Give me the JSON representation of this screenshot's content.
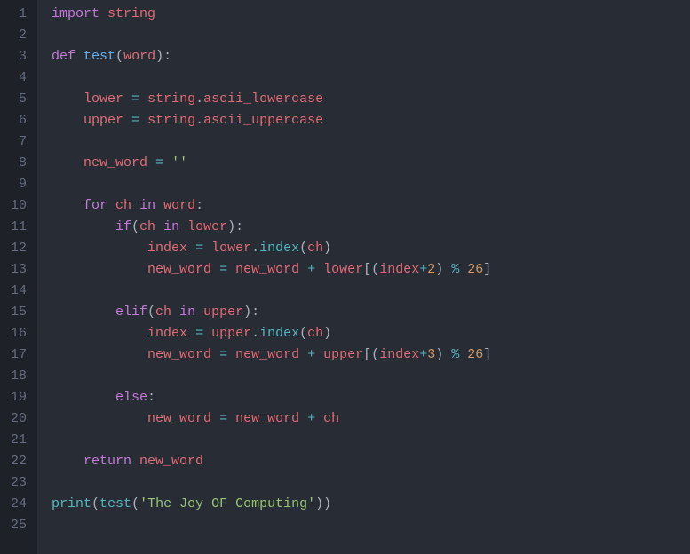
{
  "editor": {
    "lines": [
      {
        "num": "1",
        "tokens": [
          {
            "cls": "tok-import",
            "text": "import"
          },
          {
            "cls": "tok-default",
            "text": " "
          },
          {
            "cls": "tok-ident",
            "text": "string"
          }
        ]
      },
      {
        "num": "2",
        "tokens": []
      },
      {
        "num": "3",
        "tokens": [
          {
            "cls": "tok-keyword",
            "text": "def"
          },
          {
            "cls": "tok-default",
            "text": " "
          },
          {
            "cls": "tok-funcname",
            "text": "test"
          },
          {
            "cls": "tok-punct",
            "text": "("
          },
          {
            "cls": "tok-param",
            "text": "word"
          },
          {
            "cls": "tok-punct",
            "text": "):"
          }
        ]
      },
      {
        "num": "4",
        "tokens": []
      },
      {
        "num": "5",
        "tokens": [
          {
            "cls": "tok-default",
            "text": "    "
          },
          {
            "cls": "tok-ident",
            "text": "lower"
          },
          {
            "cls": "tok-default",
            "text": " "
          },
          {
            "cls": "tok-operator",
            "text": "="
          },
          {
            "cls": "tok-default",
            "text": " "
          },
          {
            "cls": "tok-ident",
            "text": "string"
          },
          {
            "cls": "tok-punct",
            "text": "."
          },
          {
            "cls": "tok-attr",
            "text": "ascii_lowercase"
          }
        ]
      },
      {
        "num": "6",
        "tokens": [
          {
            "cls": "tok-default",
            "text": "    "
          },
          {
            "cls": "tok-ident",
            "text": "upper"
          },
          {
            "cls": "tok-default",
            "text": " "
          },
          {
            "cls": "tok-operator",
            "text": "="
          },
          {
            "cls": "tok-default",
            "text": " "
          },
          {
            "cls": "tok-ident",
            "text": "string"
          },
          {
            "cls": "tok-punct",
            "text": "."
          },
          {
            "cls": "tok-attr",
            "text": "ascii_uppercase"
          }
        ]
      },
      {
        "num": "7",
        "tokens": []
      },
      {
        "num": "8",
        "tokens": [
          {
            "cls": "tok-default",
            "text": "    "
          },
          {
            "cls": "tok-ident",
            "text": "new_word"
          },
          {
            "cls": "tok-default",
            "text": " "
          },
          {
            "cls": "tok-operator",
            "text": "="
          },
          {
            "cls": "tok-default",
            "text": " "
          },
          {
            "cls": "tok-string",
            "text": "''"
          }
        ]
      },
      {
        "num": "9",
        "tokens": []
      },
      {
        "num": "10",
        "tokens": [
          {
            "cls": "tok-default",
            "text": "    "
          },
          {
            "cls": "tok-keyword",
            "text": "for"
          },
          {
            "cls": "tok-default",
            "text": " "
          },
          {
            "cls": "tok-ident",
            "text": "ch"
          },
          {
            "cls": "tok-default",
            "text": " "
          },
          {
            "cls": "tok-keyword",
            "text": "in"
          },
          {
            "cls": "tok-default",
            "text": " "
          },
          {
            "cls": "tok-ident",
            "text": "word"
          },
          {
            "cls": "tok-punct",
            "text": ":"
          }
        ]
      },
      {
        "num": "11",
        "tokens": [
          {
            "cls": "tok-default",
            "text": "        "
          },
          {
            "cls": "tok-keyword",
            "text": "if"
          },
          {
            "cls": "tok-punct",
            "text": "("
          },
          {
            "cls": "tok-ident",
            "text": "ch"
          },
          {
            "cls": "tok-default",
            "text": " "
          },
          {
            "cls": "tok-keyword",
            "text": "in"
          },
          {
            "cls": "tok-default",
            "text": " "
          },
          {
            "cls": "tok-ident",
            "text": "lower"
          },
          {
            "cls": "tok-punct",
            "text": "):"
          }
        ]
      },
      {
        "num": "12",
        "tokens": [
          {
            "cls": "tok-default",
            "text": "            "
          },
          {
            "cls": "tok-ident",
            "text": "index"
          },
          {
            "cls": "tok-default",
            "text": " "
          },
          {
            "cls": "tok-operator",
            "text": "="
          },
          {
            "cls": "tok-default",
            "text": " "
          },
          {
            "cls": "tok-ident",
            "text": "lower"
          },
          {
            "cls": "tok-punct",
            "text": "."
          },
          {
            "cls": "tok-call",
            "text": "index"
          },
          {
            "cls": "tok-punct",
            "text": "("
          },
          {
            "cls": "tok-ident",
            "text": "ch"
          },
          {
            "cls": "tok-punct",
            "text": ")"
          }
        ]
      },
      {
        "num": "13",
        "tokens": [
          {
            "cls": "tok-default",
            "text": "            "
          },
          {
            "cls": "tok-ident",
            "text": "new_word"
          },
          {
            "cls": "tok-default",
            "text": " "
          },
          {
            "cls": "tok-operator",
            "text": "="
          },
          {
            "cls": "tok-default",
            "text": " "
          },
          {
            "cls": "tok-ident",
            "text": "new_word"
          },
          {
            "cls": "tok-default",
            "text": " "
          },
          {
            "cls": "tok-operator",
            "text": "+"
          },
          {
            "cls": "tok-default",
            "text": " "
          },
          {
            "cls": "tok-ident",
            "text": "lower"
          },
          {
            "cls": "tok-punct",
            "text": "[("
          },
          {
            "cls": "tok-ident",
            "text": "index"
          },
          {
            "cls": "tok-operator",
            "text": "+"
          },
          {
            "cls": "tok-number",
            "text": "2"
          },
          {
            "cls": "tok-punct",
            "text": ") "
          },
          {
            "cls": "tok-operator",
            "text": "%"
          },
          {
            "cls": "tok-default",
            "text": " "
          },
          {
            "cls": "tok-number",
            "text": "26"
          },
          {
            "cls": "tok-punct",
            "text": "]"
          }
        ]
      },
      {
        "num": "14",
        "tokens": []
      },
      {
        "num": "15",
        "tokens": [
          {
            "cls": "tok-default",
            "text": "        "
          },
          {
            "cls": "tok-keyword",
            "text": "elif"
          },
          {
            "cls": "tok-punct",
            "text": "("
          },
          {
            "cls": "tok-ident",
            "text": "ch"
          },
          {
            "cls": "tok-default",
            "text": " "
          },
          {
            "cls": "tok-keyword",
            "text": "in"
          },
          {
            "cls": "tok-default",
            "text": " "
          },
          {
            "cls": "tok-ident",
            "text": "upper"
          },
          {
            "cls": "tok-punct",
            "text": "):"
          }
        ]
      },
      {
        "num": "16",
        "tokens": [
          {
            "cls": "tok-default",
            "text": "            "
          },
          {
            "cls": "tok-ident",
            "text": "index"
          },
          {
            "cls": "tok-default",
            "text": " "
          },
          {
            "cls": "tok-operator",
            "text": "="
          },
          {
            "cls": "tok-default",
            "text": " "
          },
          {
            "cls": "tok-ident",
            "text": "upper"
          },
          {
            "cls": "tok-punct",
            "text": "."
          },
          {
            "cls": "tok-call",
            "text": "index"
          },
          {
            "cls": "tok-punct",
            "text": "("
          },
          {
            "cls": "tok-ident",
            "text": "ch"
          },
          {
            "cls": "tok-punct",
            "text": ")"
          }
        ]
      },
      {
        "num": "17",
        "tokens": [
          {
            "cls": "tok-default",
            "text": "            "
          },
          {
            "cls": "tok-ident",
            "text": "new_word"
          },
          {
            "cls": "tok-default",
            "text": " "
          },
          {
            "cls": "tok-operator",
            "text": "="
          },
          {
            "cls": "tok-default",
            "text": " "
          },
          {
            "cls": "tok-ident",
            "text": "new_word"
          },
          {
            "cls": "tok-default",
            "text": " "
          },
          {
            "cls": "tok-operator",
            "text": "+"
          },
          {
            "cls": "tok-default",
            "text": " "
          },
          {
            "cls": "tok-ident",
            "text": "upper"
          },
          {
            "cls": "tok-punct",
            "text": "[("
          },
          {
            "cls": "tok-ident",
            "text": "index"
          },
          {
            "cls": "tok-operator",
            "text": "+"
          },
          {
            "cls": "tok-number",
            "text": "3"
          },
          {
            "cls": "tok-punct",
            "text": ") "
          },
          {
            "cls": "tok-operator",
            "text": "%"
          },
          {
            "cls": "tok-default",
            "text": " "
          },
          {
            "cls": "tok-number",
            "text": "26"
          },
          {
            "cls": "tok-punct",
            "text": "]"
          }
        ]
      },
      {
        "num": "18",
        "tokens": []
      },
      {
        "num": "19",
        "tokens": [
          {
            "cls": "tok-default",
            "text": "        "
          },
          {
            "cls": "tok-keyword",
            "text": "else"
          },
          {
            "cls": "tok-punct",
            "text": ":"
          }
        ]
      },
      {
        "num": "20",
        "tokens": [
          {
            "cls": "tok-default",
            "text": "            "
          },
          {
            "cls": "tok-ident",
            "text": "new_word"
          },
          {
            "cls": "tok-default",
            "text": " "
          },
          {
            "cls": "tok-operator",
            "text": "="
          },
          {
            "cls": "tok-default",
            "text": " "
          },
          {
            "cls": "tok-ident",
            "text": "new_word"
          },
          {
            "cls": "tok-default",
            "text": " "
          },
          {
            "cls": "tok-operator",
            "text": "+"
          },
          {
            "cls": "tok-default",
            "text": " "
          },
          {
            "cls": "tok-ident",
            "text": "ch"
          }
        ]
      },
      {
        "num": "21",
        "tokens": []
      },
      {
        "num": "22",
        "tokens": [
          {
            "cls": "tok-default",
            "text": "    "
          },
          {
            "cls": "tok-keyword",
            "text": "return"
          },
          {
            "cls": "tok-default",
            "text": " "
          },
          {
            "cls": "tok-ident",
            "text": "new_word"
          }
        ]
      },
      {
        "num": "23",
        "tokens": []
      },
      {
        "num": "24",
        "tokens": [
          {
            "cls": "tok-builtin",
            "text": "print"
          },
          {
            "cls": "tok-punct",
            "text": "("
          },
          {
            "cls": "tok-call",
            "text": "test"
          },
          {
            "cls": "tok-punct",
            "text": "("
          },
          {
            "cls": "tok-string",
            "text": "'The Joy OF Computing'"
          },
          {
            "cls": "tok-punct",
            "text": "))"
          }
        ]
      },
      {
        "num": "25",
        "tokens": []
      }
    ]
  }
}
